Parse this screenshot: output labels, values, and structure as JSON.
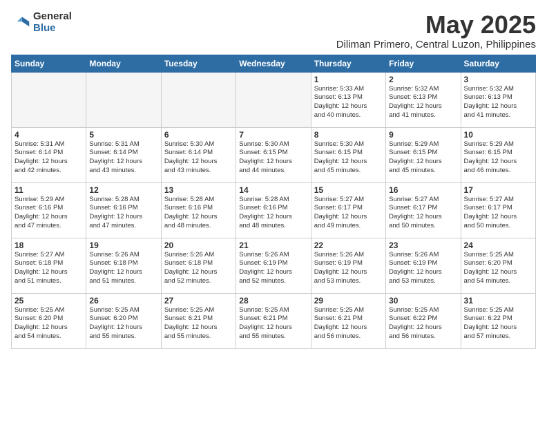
{
  "logo": {
    "general": "General",
    "blue": "Blue"
  },
  "title": "May 2025",
  "subtitle": "Diliman Primero, Central Luzon, Philippines",
  "weekdays": [
    "Sunday",
    "Monday",
    "Tuesday",
    "Wednesday",
    "Thursday",
    "Friday",
    "Saturday"
  ],
  "weeks": [
    [
      {
        "day": "",
        "info": ""
      },
      {
        "day": "",
        "info": ""
      },
      {
        "day": "",
        "info": ""
      },
      {
        "day": "",
        "info": ""
      },
      {
        "day": "1",
        "info": "Sunrise: 5:33 AM\nSunset: 6:13 PM\nDaylight: 12 hours\nand 40 minutes."
      },
      {
        "day": "2",
        "info": "Sunrise: 5:32 AM\nSunset: 6:13 PM\nDaylight: 12 hours\nand 41 minutes."
      },
      {
        "day": "3",
        "info": "Sunrise: 5:32 AM\nSunset: 6:13 PM\nDaylight: 12 hours\nand 41 minutes."
      }
    ],
    [
      {
        "day": "4",
        "info": "Sunrise: 5:31 AM\nSunset: 6:14 PM\nDaylight: 12 hours\nand 42 minutes."
      },
      {
        "day": "5",
        "info": "Sunrise: 5:31 AM\nSunset: 6:14 PM\nDaylight: 12 hours\nand 43 minutes."
      },
      {
        "day": "6",
        "info": "Sunrise: 5:30 AM\nSunset: 6:14 PM\nDaylight: 12 hours\nand 43 minutes."
      },
      {
        "day": "7",
        "info": "Sunrise: 5:30 AM\nSunset: 6:15 PM\nDaylight: 12 hours\nand 44 minutes."
      },
      {
        "day": "8",
        "info": "Sunrise: 5:30 AM\nSunset: 6:15 PM\nDaylight: 12 hours\nand 45 minutes."
      },
      {
        "day": "9",
        "info": "Sunrise: 5:29 AM\nSunset: 6:15 PM\nDaylight: 12 hours\nand 45 minutes."
      },
      {
        "day": "10",
        "info": "Sunrise: 5:29 AM\nSunset: 6:15 PM\nDaylight: 12 hours\nand 46 minutes."
      }
    ],
    [
      {
        "day": "11",
        "info": "Sunrise: 5:29 AM\nSunset: 6:16 PM\nDaylight: 12 hours\nand 47 minutes."
      },
      {
        "day": "12",
        "info": "Sunrise: 5:28 AM\nSunset: 6:16 PM\nDaylight: 12 hours\nand 47 minutes."
      },
      {
        "day": "13",
        "info": "Sunrise: 5:28 AM\nSunset: 6:16 PM\nDaylight: 12 hours\nand 48 minutes."
      },
      {
        "day": "14",
        "info": "Sunrise: 5:28 AM\nSunset: 6:16 PM\nDaylight: 12 hours\nand 48 minutes."
      },
      {
        "day": "15",
        "info": "Sunrise: 5:27 AM\nSunset: 6:17 PM\nDaylight: 12 hours\nand 49 minutes."
      },
      {
        "day": "16",
        "info": "Sunrise: 5:27 AM\nSunset: 6:17 PM\nDaylight: 12 hours\nand 50 minutes."
      },
      {
        "day": "17",
        "info": "Sunrise: 5:27 AM\nSunset: 6:17 PM\nDaylight: 12 hours\nand 50 minutes."
      }
    ],
    [
      {
        "day": "18",
        "info": "Sunrise: 5:27 AM\nSunset: 6:18 PM\nDaylight: 12 hours\nand 51 minutes."
      },
      {
        "day": "19",
        "info": "Sunrise: 5:26 AM\nSunset: 6:18 PM\nDaylight: 12 hours\nand 51 minutes."
      },
      {
        "day": "20",
        "info": "Sunrise: 5:26 AM\nSunset: 6:18 PM\nDaylight: 12 hours\nand 52 minutes."
      },
      {
        "day": "21",
        "info": "Sunrise: 5:26 AM\nSunset: 6:19 PM\nDaylight: 12 hours\nand 52 minutes."
      },
      {
        "day": "22",
        "info": "Sunrise: 5:26 AM\nSunset: 6:19 PM\nDaylight: 12 hours\nand 53 minutes."
      },
      {
        "day": "23",
        "info": "Sunrise: 5:26 AM\nSunset: 6:19 PM\nDaylight: 12 hours\nand 53 minutes."
      },
      {
        "day": "24",
        "info": "Sunrise: 5:25 AM\nSunset: 6:20 PM\nDaylight: 12 hours\nand 54 minutes."
      }
    ],
    [
      {
        "day": "25",
        "info": "Sunrise: 5:25 AM\nSunset: 6:20 PM\nDaylight: 12 hours\nand 54 minutes."
      },
      {
        "day": "26",
        "info": "Sunrise: 5:25 AM\nSunset: 6:20 PM\nDaylight: 12 hours\nand 55 minutes."
      },
      {
        "day": "27",
        "info": "Sunrise: 5:25 AM\nSunset: 6:21 PM\nDaylight: 12 hours\nand 55 minutes."
      },
      {
        "day": "28",
        "info": "Sunrise: 5:25 AM\nSunset: 6:21 PM\nDaylight: 12 hours\nand 55 minutes."
      },
      {
        "day": "29",
        "info": "Sunrise: 5:25 AM\nSunset: 6:21 PM\nDaylight: 12 hours\nand 56 minutes."
      },
      {
        "day": "30",
        "info": "Sunrise: 5:25 AM\nSunset: 6:22 PM\nDaylight: 12 hours\nand 56 minutes."
      },
      {
        "day": "31",
        "info": "Sunrise: 5:25 AM\nSunset: 6:22 PM\nDaylight: 12 hours\nand 57 minutes."
      }
    ]
  ]
}
